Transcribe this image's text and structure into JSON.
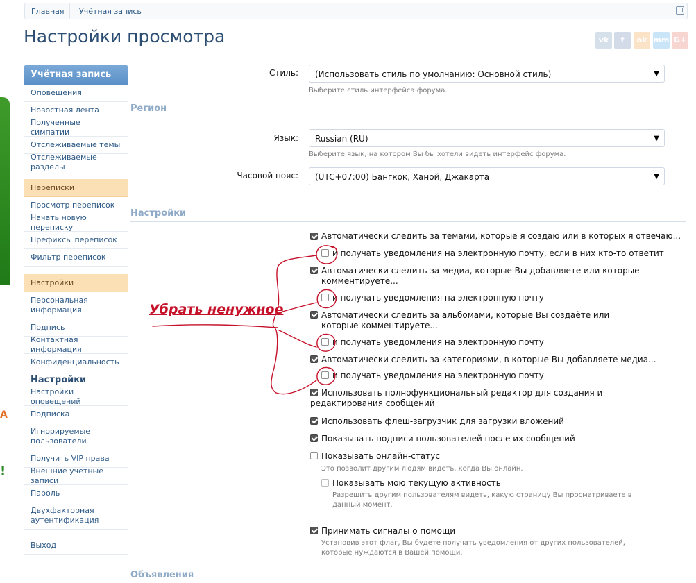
{
  "breadcrumb": {
    "items": [
      "Главная",
      "Учётная запись"
    ]
  },
  "page": {
    "title": "Настройки просмотра"
  },
  "share": [
    {
      "label": "vk",
      "icon": "vk-icon",
      "color": "#4a76a8"
    },
    {
      "label": "f",
      "icon": "facebook-icon",
      "color": "#3b5998"
    },
    {
      "label": "ok",
      "icon": "odnoklassniki-icon",
      "color": "#ee8208"
    },
    {
      "label": "mm",
      "icon": "moimir-icon",
      "color": "#168de2"
    },
    {
      "label": "G+",
      "icon": "googleplus-icon",
      "color": "#dd4b39"
    }
  ],
  "sidebar": {
    "title": "Учётная запись",
    "account_items": [
      "Оповещения",
      "Новостная лента",
      "Полученные симпатии",
      "Отслеживаемые темы",
      "Отслеживаемые разделы"
    ],
    "group_conversations": "Переписки",
    "conversation_items": [
      "Просмотр переписок",
      "Начать новую переписку",
      "Префиксы переписок",
      "Фильтр переписок"
    ],
    "group_settings": "Настройки",
    "settings_items": [
      "Персональная информация",
      "Подпись",
      "Контактная информация",
      "Конфиденциальность"
    ],
    "current": "Настройки",
    "settings_items2": [
      "Настройки оповещений",
      "Подписка",
      "Игнорируемые пользователи",
      "Получить VIP права",
      "Внешние учётные записи",
      "Пароль",
      "Двухфакторная аутентификация"
    ],
    "logout": "Выход"
  },
  "form": {
    "style_label": "Стиль:",
    "style_value": "(Использовать стиль по умолчанию: Основной стиль)",
    "style_hint": "Выберите стиль интерфейса форума.",
    "region_title": "Регион",
    "language_label": "Язык:",
    "language_value": "Russian (RU)",
    "language_hint": "Выберите язык, на котором Вы бы хотели видеть интерфейс форума.",
    "timezone_label": "Часовой пояс:",
    "timezone_value": "(UTC+07:00) Бангкок, Ханой, Джакарта",
    "settings_title": "Настройки",
    "options": [
      {
        "text": "Автоматически следить за темами, которые я создаю или в которых я отвечаю...",
        "checked": true
      },
      {
        "text": "и получать уведомления на электронную почту, если в них кто-то ответит",
        "checked": false
      },
      {
        "text": "Автоматически следить за медиа, которые Вы добавляете или которые комментируете...",
        "checked": true
      },
      {
        "text": "и получать уведомления на электронную почту",
        "checked": false
      },
      {
        "text": "Автоматически следить за альбомами, которые Вы создаёте или которые комментируете...",
        "checked": true
      },
      {
        "text": "и получать уведомления на электронную почту",
        "checked": false
      },
      {
        "text": "Автоматически следить за категориями, в которые Вы добавляете медиа...",
        "checked": true
      },
      {
        "text": "и получать уведомления на электронную почту",
        "checked": false
      },
      {
        "text": "Использовать полнофункциональный редактор для создания и редактирования сообщений",
        "checked": true
      },
      {
        "text": "Использовать флеш-загрузчик для загрузки вложений",
        "checked": true
      },
      {
        "text": "Показывать подписи пользователей после их сообщений",
        "checked": true
      },
      {
        "text": "Показывать онлайн-статус",
        "checked": false
      },
      {
        "text": "Показывать мою текущую активность",
        "checked": false
      },
      {
        "text": "Принимать сигналы о помощи",
        "checked": true
      }
    ],
    "online_hint": "Это позволит другим людям видеть, когда Вы онлайн.",
    "activity_hint": "Разрешить другим пользователям видеть, какую страницу Вы просматриваете в данный момент.",
    "help_hint": "Установив этот флаг, Вы будете получать уведомления от других пользователей, которые нуждаются в Вашей помощи.",
    "ads_title": "Объявления"
  },
  "annotation": "Убрать ненужное"
}
